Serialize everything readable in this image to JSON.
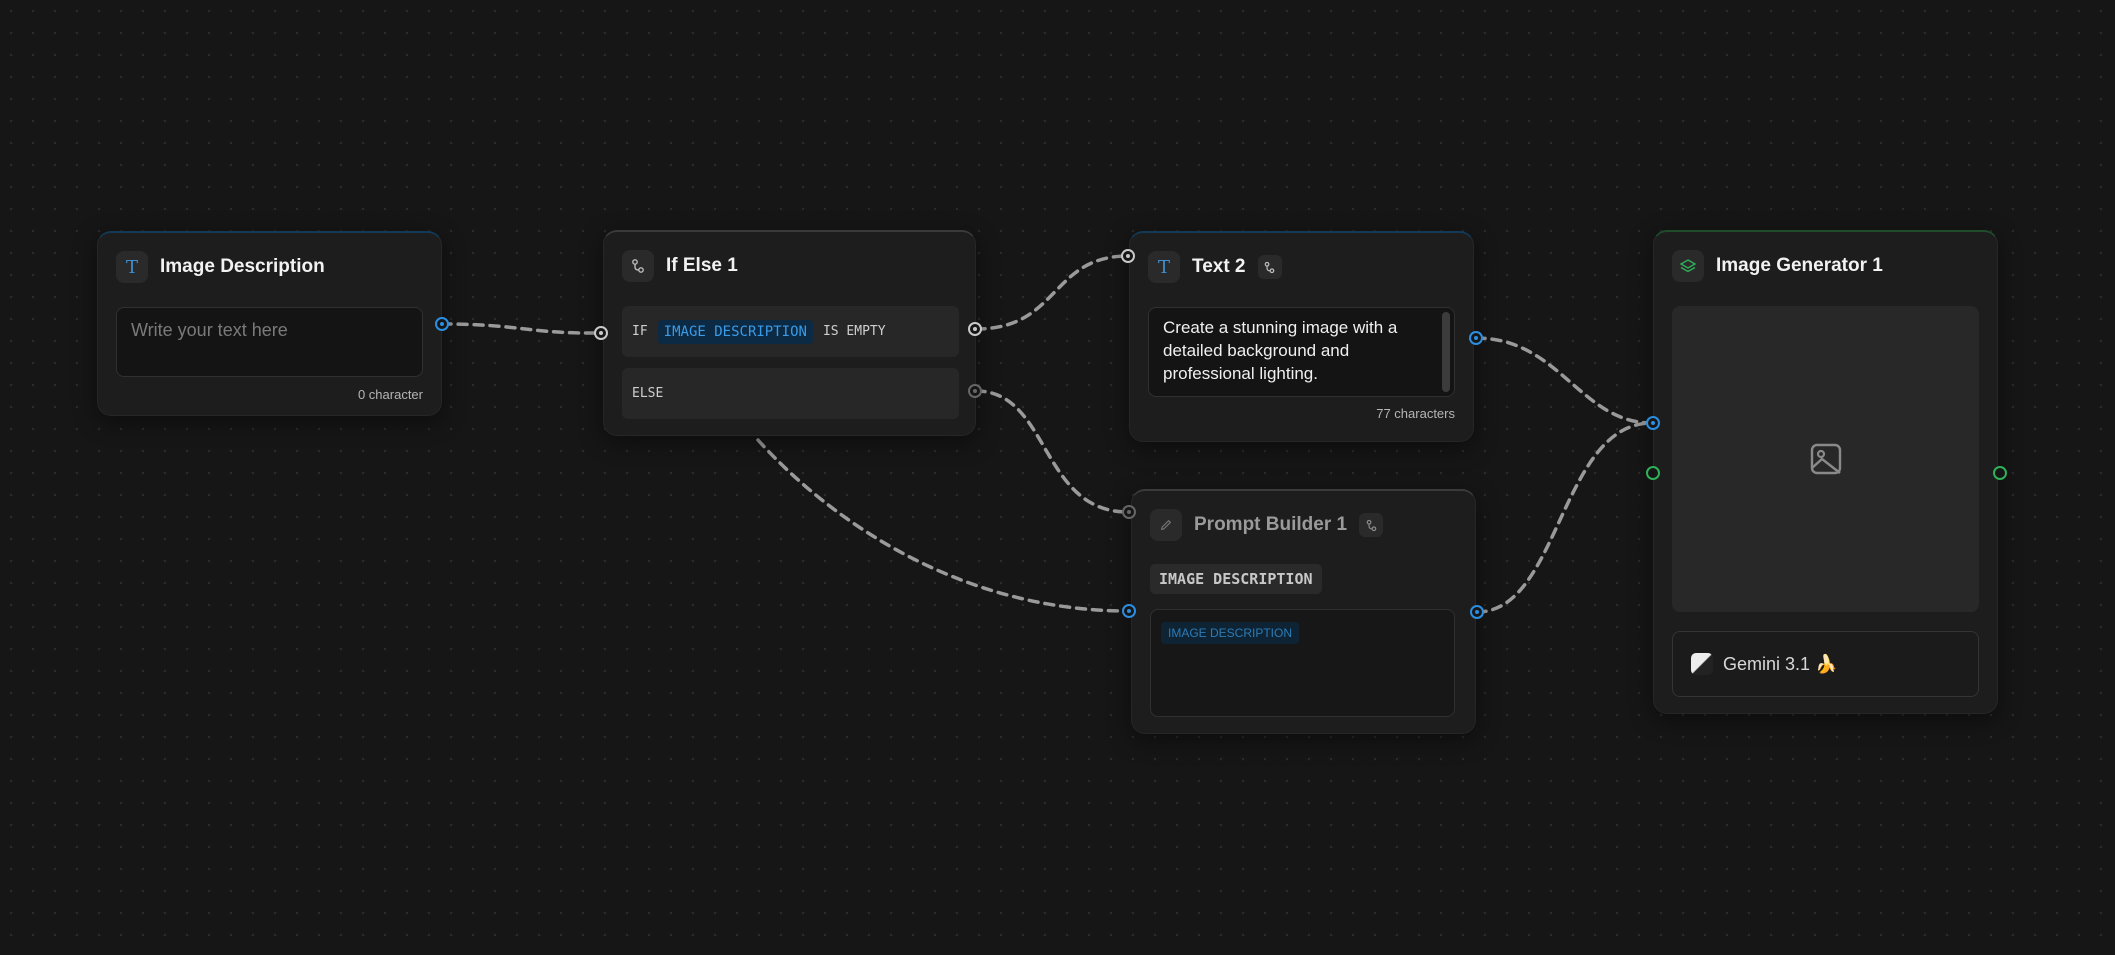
{
  "nodes": {
    "image_description": {
      "title": "Image Description",
      "icon": "text-icon",
      "placeholder": "Write your text here",
      "value": "",
      "count": "0 character"
    },
    "if_else": {
      "title": "If Else 1",
      "icon": "branch-icon",
      "if_keyword": "IF",
      "variable": "IMAGE DESCRIPTION",
      "condition": "IS EMPTY",
      "else_keyword": "ELSE"
    },
    "text2": {
      "title": "Text 2",
      "icon": "text-icon",
      "value": "Create a stunning image with a detailed background and professional lighting.",
      "count": "77 characters"
    },
    "prompt_builder": {
      "title": "Prompt Builder 1",
      "icon": "pencil-icon",
      "variable_label": "IMAGE DESCRIPTION",
      "chip": "IMAGE DESCRIPTION"
    },
    "image_generator": {
      "title": "Image Generator 1",
      "icon": "layers-icon",
      "model": "Gemini 3.1 🍌"
    }
  },
  "colors": {
    "canvas": "#161616",
    "node": "#1d1d1d",
    "accent_blue": "#2b8ee0",
    "accent_green": "#2fb15a",
    "edge": "#9a9a9a"
  }
}
